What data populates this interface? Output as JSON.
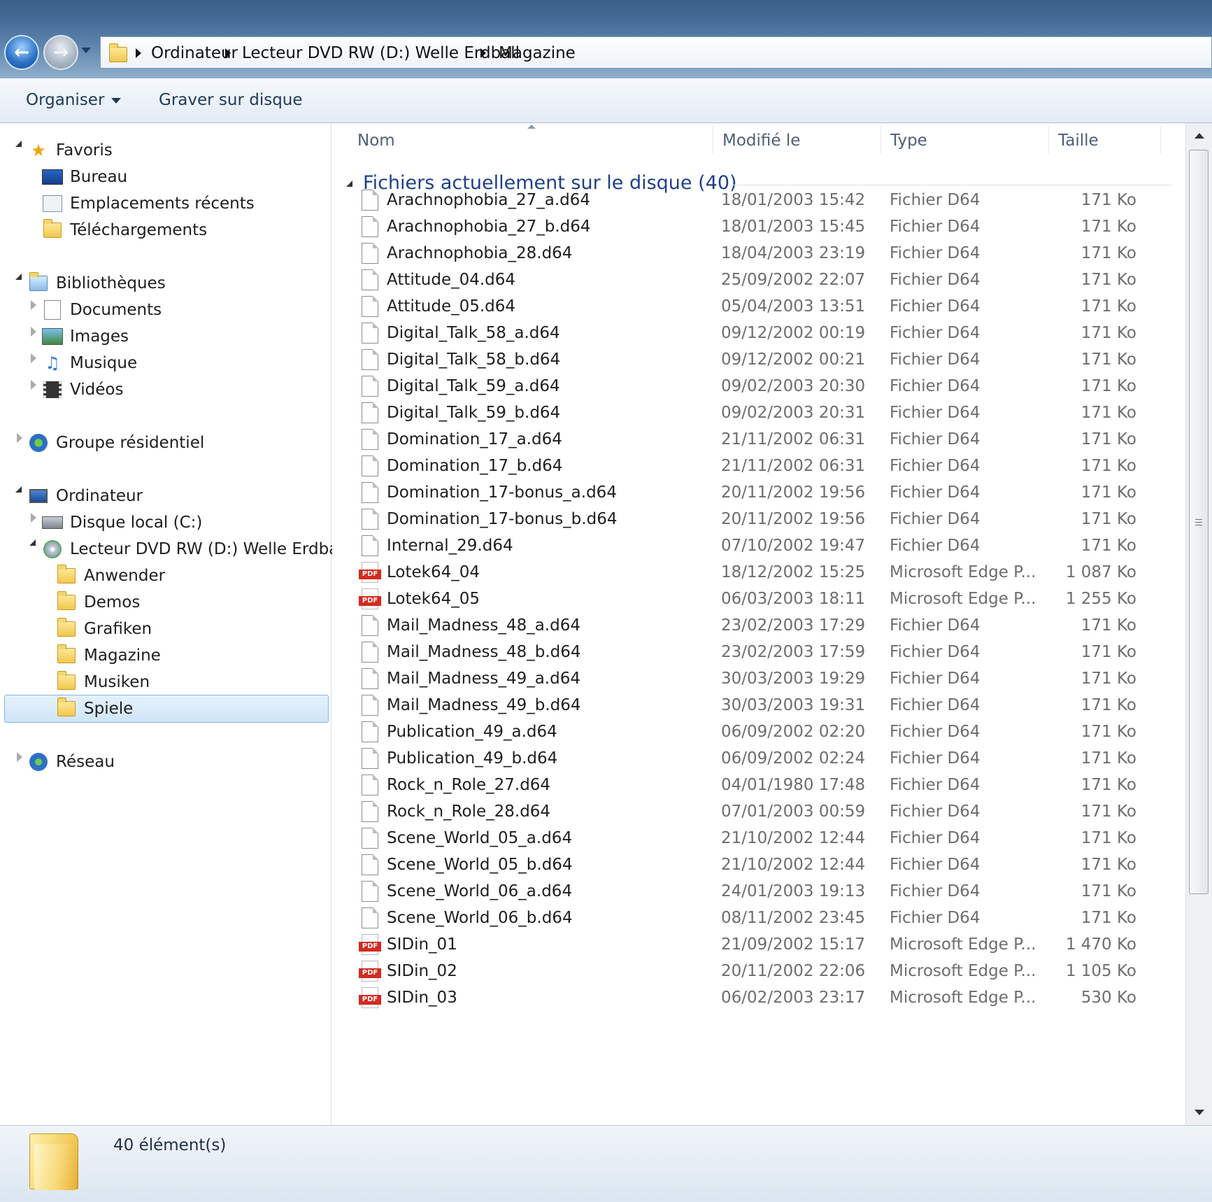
{
  "address": {
    "breadcrumbs": [
      "Ordinateur",
      "Lecteur DVD RW (D:) Welle Erdball",
      "Magazine"
    ]
  },
  "toolbar": {
    "organize_label": "Organiser",
    "burn_label": "Graver sur disque"
  },
  "nav": {
    "items": [
      {
        "label": "Favoris",
        "icon": "star-icon"
      },
      {
        "label": "Bureau",
        "icon": "desktop-icon"
      },
      {
        "label": "Emplacements récents",
        "icon": "recent-places-icon"
      },
      {
        "label": "Téléchargements",
        "icon": "downloads-folder-icon"
      },
      {
        "label": "Bibliothèques",
        "icon": "libraries-icon"
      },
      {
        "label": "Documents",
        "icon": "documents-icon"
      },
      {
        "label": "Images",
        "icon": "images-icon"
      },
      {
        "label": "Musique",
        "icon": "music-icon"
      },
      {
        "label": "Vidéos",
        "icon": "videos-icon"
      },
      {
        "label": "Groupe résidentiel",
        "icon": "homegroup-icon"
      },
      {
        "label": "Ordinateur",
        "icon": "computer-icon"
      },
      {
        "label": "Disque local (C:)",
        "icon": "local-disk-icon"
      },
      {
        "label": "Lecteur DVD RW (D:) Welle Erdball",
        "icon": "dvd-drive-icon"
      },
      {
        "label": "Anwender",
        "icon": "folder-icon"
      },
      {
        "label": "Demos",
        "icon": "folder-icon"
      },
      {
        "label": "Grafiken",
        "icon": "folder-icon"
      },
      {
        "label": "Magazine",
        "icon": "folder-icon",
        "selected": true
      },
      {
        "label": "Musiken",
        "icon": "folder-icon"
      },
      {
        "label": "Spiele",
        "icon": "folder-icon"
      },
      {
        "label": "Réseau",
        "icon": "network-icon"
      }
    ]
  },
  "columns": {
    "name": "Nom",
    "modified": "Modifié le",
    "type": "Type",
    "size": "Taille"
  },
  "group": {
    "title": "Fichiers actuellement sur le disque (40)"
  },
  "files": [
    {
      "name": "Arachnophobia_27_a.d64",
      "modified": "18/01/2003 15:42",
      "type": "Fichier D64",
      "size": "171 Ko",
      "icon": "file-icon"
    },
    {
      "name": "Arachnophobia_27_b.d64",
      "modified": "18/01/2003 15:45",
      "type": "Fichier D64",
      "size": "171 Ko",
      "icon": "file-icon"
    },
    {
      "name": "Arachnophobia_28.d64",
      "modified": "18/04/2003 23:19",
      "type": "Fichier D64",
      "size": "171 Ko",
      "icon": "file-icon"
    },
    {
      "name": "Attitude_04.d64",
      "modified": "25/09/2002 22:07",
      "type": "Fichier D64",
      "size": "171 Ko",
      "icon": "file-icon"
    },
    {
      "name": "Attitude_05.d64",
      "modified": "05/04/2003 13:51",
      "type": "Fichier D64",
      "size": "171 Ko",
      "icon": "file-icon"
    },
    {
      "name": "Digital_Talk_58_a.d64",
      "modified": "09/12/2002 00:19",
      "type": "Fichier D64",
      "size": "171 Ko",
      "icon": "file-icon"
    },
    {
      "name": "Digital_Talk_58_b.d64",
      "modified": "09/12/2002 00:21",
      "type": "Fichier D64",
      "size": "171 Ko",
      "icon": "file-icon"
    },
    {
      "name": "Digital_Talk_59_a.d64",
      "modified": "09/02/2003 20:30",
      "type": "Fichier D64",
      "size": "171 Ko",
      "icon": "file-icon"
    },
    {
      "name": "Digital_Talk_59_b.d64",
      "modified": "09/02/2003 20:31",
      "type": "Fichier D64",
      "size": "171 Ko",
      "icon": "file-icon"
    },
    {
      "name": "Domination_17_a.d64",
      "modified": "21/11/2002 06:31",
      "type": "Fichier D64",
      "size": "171 Ko",
      "icon": "file-icon"
    },
    {
      "name": "Domination_17_b.d64",
      "modified": "21/11/2002 06:31",
      "type": "Fichier D64",
      "size": "171 Ko",
      "icon": "file-icon"
    },
    {
      "name": "Domination_17-bonus_a.d64",
      "modified": "20/11/2002 19:56",
      "type": "Fichier D64",
      "size": "171 Ko",
      "icon": "file-icon"
    },
    {
      "name": "Domination_17-bonus_b.d64",
      "modified": "20/11/2002 19:56",
      "type": "Fichier D64",
      "size": "171 Ko",
      "icon": "file-icon"
    },
    {
      "name": "Internal_29.d64",
      "modified": "07/10/2002 19:47",
      "type": "Fichier D64",
      "size": "171 Ko",
      "icon": "file-icon"
    },
    {
      "name": "Lotek64_04",
      "modified": "18/12/2002 15:25",
      "type": "Microsoft Edge P...",
      "size": "1 087 Ko",
      "icon": "pdf-icon"
    },
    {
      "name": "Lotek64_05",
      "modified": "06/03/2003 18:11",
      "type": "Microsoft Edge P...",
      "size": "1 255 Ko",
      "icon": "pdf-icon"
    },
    {
      "name": "Mail_Madness_48_a.d64",
      "modified": "23/02/2003 17:29",
      "type": "Fichier D64",
      "size": "171 Ko",
      "icon": "file-icon"
    },
    {
      "name": "Mail_Madness_48_b.d64",
      "modified": "23/02/2003 17:59",
      "type": "Fichier D64",
      "size": "171 Ko",
      "icon": "file-icon"
    },
    {
      "name": "Mail_Madness_49_a.d64",
      "modified": "30/03/2003 19:29",
      "type": "Fichier D64",
      "size": "171 Ko",
      "icon": "file-icon"
    },
    {
      "name": "Mail_Madness_49_b.d64",
      "modified": "30/03/2003 19:31",
      "type": "Fichier D64",
      "size": "171 Ko",
      "icon": "file-icon"
    },
    {
      "name": "Publication_49_a.d64",
      "modified": "06/09/2002 02:20",
      "type": "Fichier D64",
      "size": "171 Ko",
      "icon": "file-icon"
    },
    {
      "name": "Publication_49_b.d64",
      "modified": "06/09/2002 02:24",
      "type": "Fichier D64",
      "size": "171 Ko",
      "icon": "file-icon"
    },
    {
      "name": "Rock_n_Role_27.d64",
      "modified": "04/01/1980 17:48",
      "type": "Fichier D64",
      "size": "171 Ko",
      "icon": "file-icon"
    },
    {
      "name": "Rock_n_Role_28.d64",
      "modified": "07/01/2003 00:59",
      "type": "Fichier D64",
      "size": "171 Ko",
      "icon": "file-icon"
    },
    {
      "name": "Scene_World_05_a.d64",
      "modified": "21/10/2002 12:44",
      "type": "Fichier D64",
      "size": "171 Ko",
      "icon": "file-icon"
    },
    {
      "name": "Scene_World_05_b.d64",
      "modified": "21/10/2002 12:44",
      "type": "Fichier D64",
      "size": "171 Ko",
      "icon": "file-icon"
    },
    {
      "name": "Scene_World_06_a.d64",
      "modified": "24/01/2003 19:13",
      "type": "Fichier D64",
      "size": "171 Ko",
      "icon": "file-icon"
    },
    {
      "name": "Scene_World_06_b.d64",
      "modified": "08/11/2002 23:45",
      "type": "Fichier D64",
      "size": "171 Ko",
      "icon": "file-icon"
    },
    {
      "name": "SIDin_01",
      "modified": "21/09/2002 15:17",
      "type": "Microsoft Edge P...",
      "size": "1 470 Ko",
      "icon": "pdf-icon"
    },
    {
      "name": "SIDin_02",
      "modified": "20/11/2002 22:06",
      "type": "Microsoft Edge P...",
      "size": "1 105 Ko",
      "icon": "pdf-icon"
    },
    {
      "name": "SIDin_03",
      "modified": "06/02/2003 23:17",
      "type": "Microsoft Edge P...",
      "size": "530 Ko",
      "icon": "pdf-icon"
    }
  ],
  "status": {
    "text": "40 élément(s)"
  }
}
